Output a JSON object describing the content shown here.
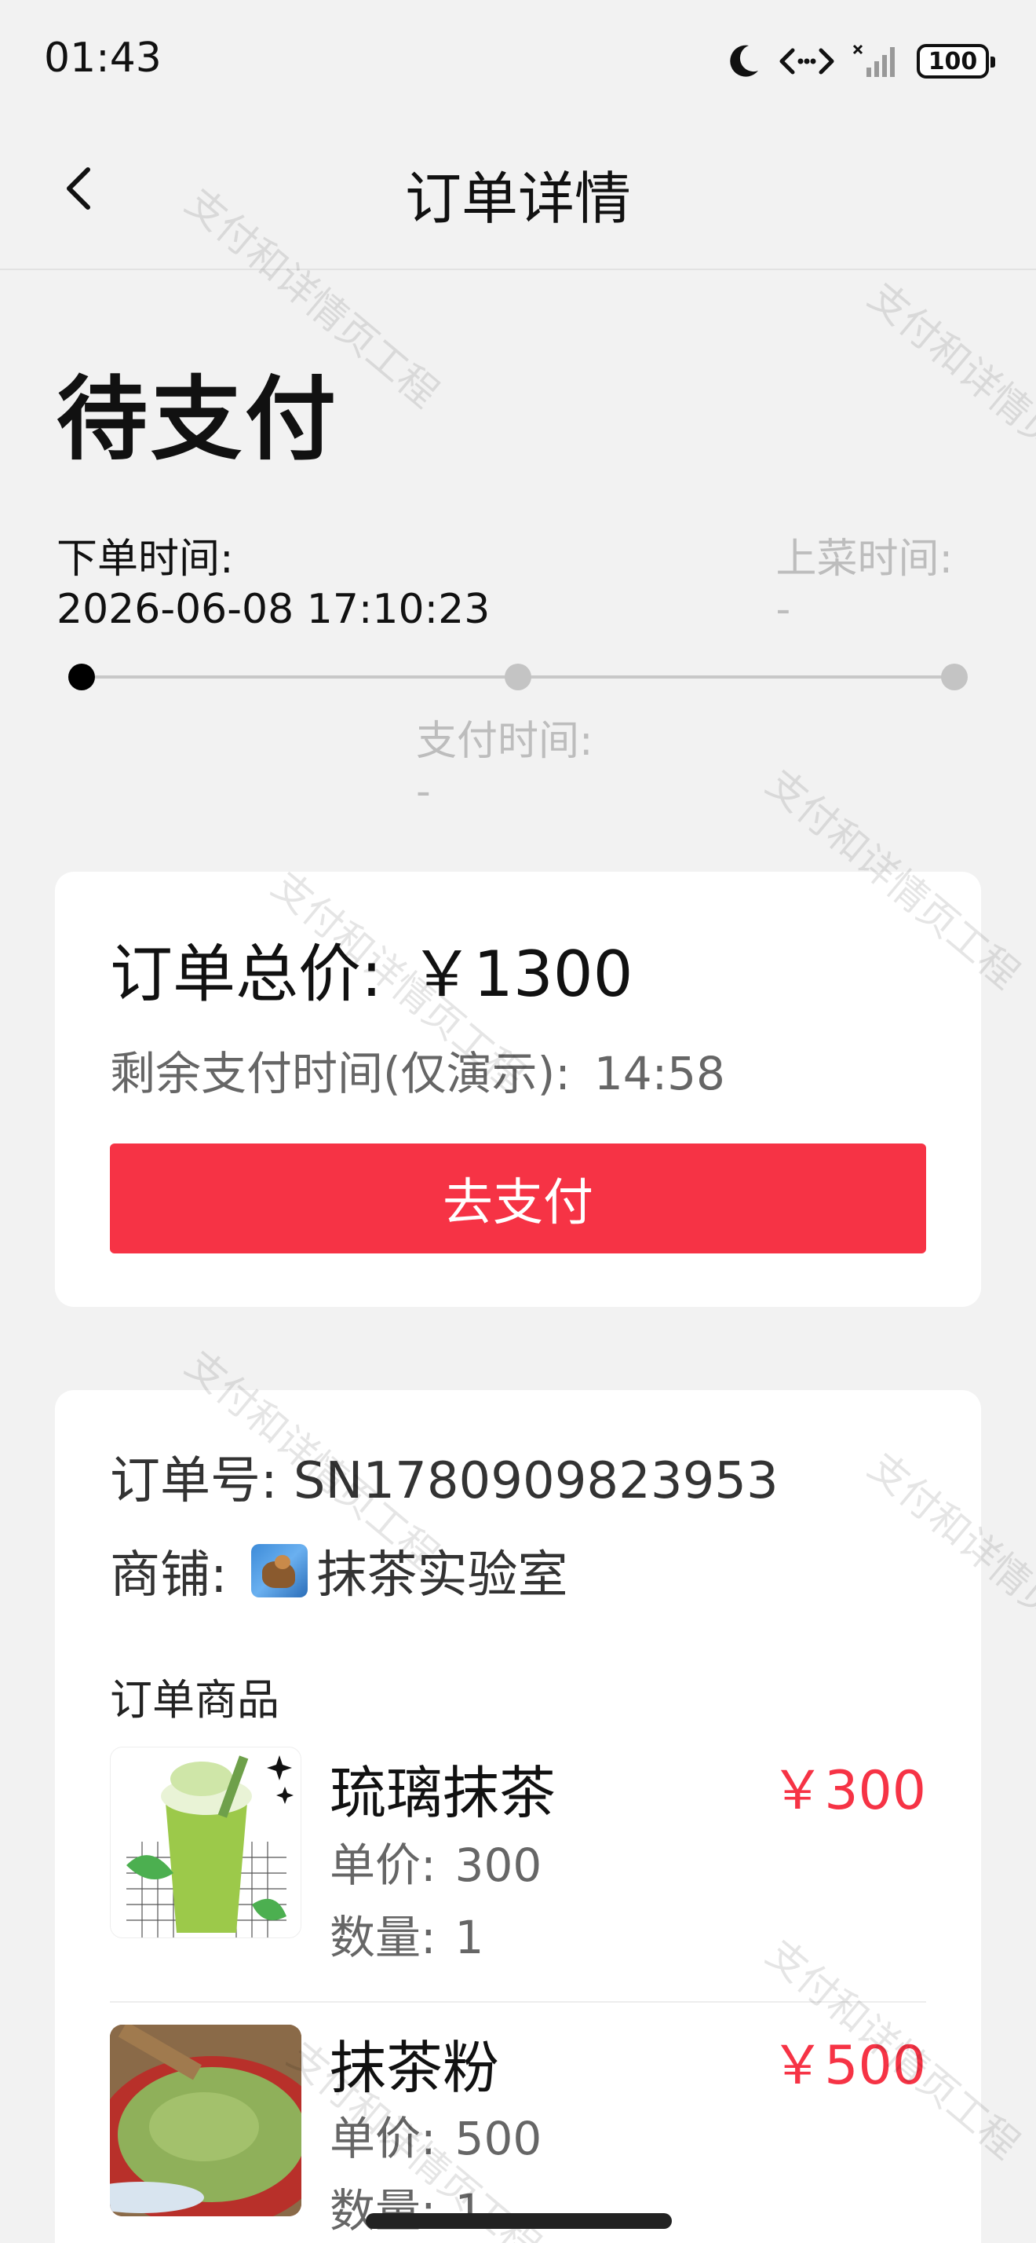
{
  "status_bar": {
    "time": "01:43",
    "battery": "100"
  },
  "nav": {
    "title": "订单详情"
  },
  "order_status": "待支付",
  "timeline": {
    "order_time_label": "下单时间:",
    "order_time_value": "2026-06-08 17:10:23",
    "serve_time_label": "上菜时间:",
    "serve_time_value": "-",
    "pay_time_label": "支付时间:",
    "pay_time_value": "-"
  },
  "payment": {
    "total_label": "订单总价:",
    "total_value": "￥1300",
    "countdown_label": "剩余支付时间(仅演示):",
    "countdown_value": "14:58",
    "pay_button": "去支付"
  },
  "order": {
    "order_no_text": "订单号: SN1780909823953",
    "shop_label": "商铺:",
    "shop_name": "抹茶实验室",
    "items_title": "订单商品",
    "unit_label": "单价:",
    "qty_label": "数量:",
    "items": [
      {
        "name": "琉璃抹茶",
        "price": "￥300",
        "unit_price": "300",
        "qty": "1"
      },
      {
        "name": "抹茶粉",
        "price": "￥500",
        "unit_price": "500",
        "qty": "1"
      }
    ]
  },
  "watermark": "支付和详情页工程",
  "colors": {
    "accent": "#f63345",
    "background": "#f2f2f2",
    "muted": "#bdbdbd"
  }
}
